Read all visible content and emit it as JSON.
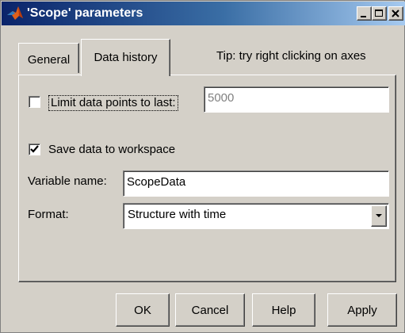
{
  "window": {
    "title": "'Scope' parameters"
  },
  "tabs": [
    {
      "label": "General",
      "selected": false
    },
    {
      "label": "Data history",
      "selected": true
    }
  ],
  "tip": "Tip: try right clicking on axes",
  "limit_points": {
    "label": "Limit data points to last:",
    "checked": false,
    "value": "5000",
    "enabled": false
  },
  "save_workspace": {
    "label": "Save data to workspace",
    "checked": true
  },
  "variable_name": {
    "label": "Variable name:",
    "value": "ScopeData"
  },
  "format": {
    "label": "Format:",
    "selected": "Structure with time"
  },
  "buttons": {
    "ok": "OK",
    "cancel": "Cancel",
    "help": "Help",
    "apply": "Apply"
  }
}
